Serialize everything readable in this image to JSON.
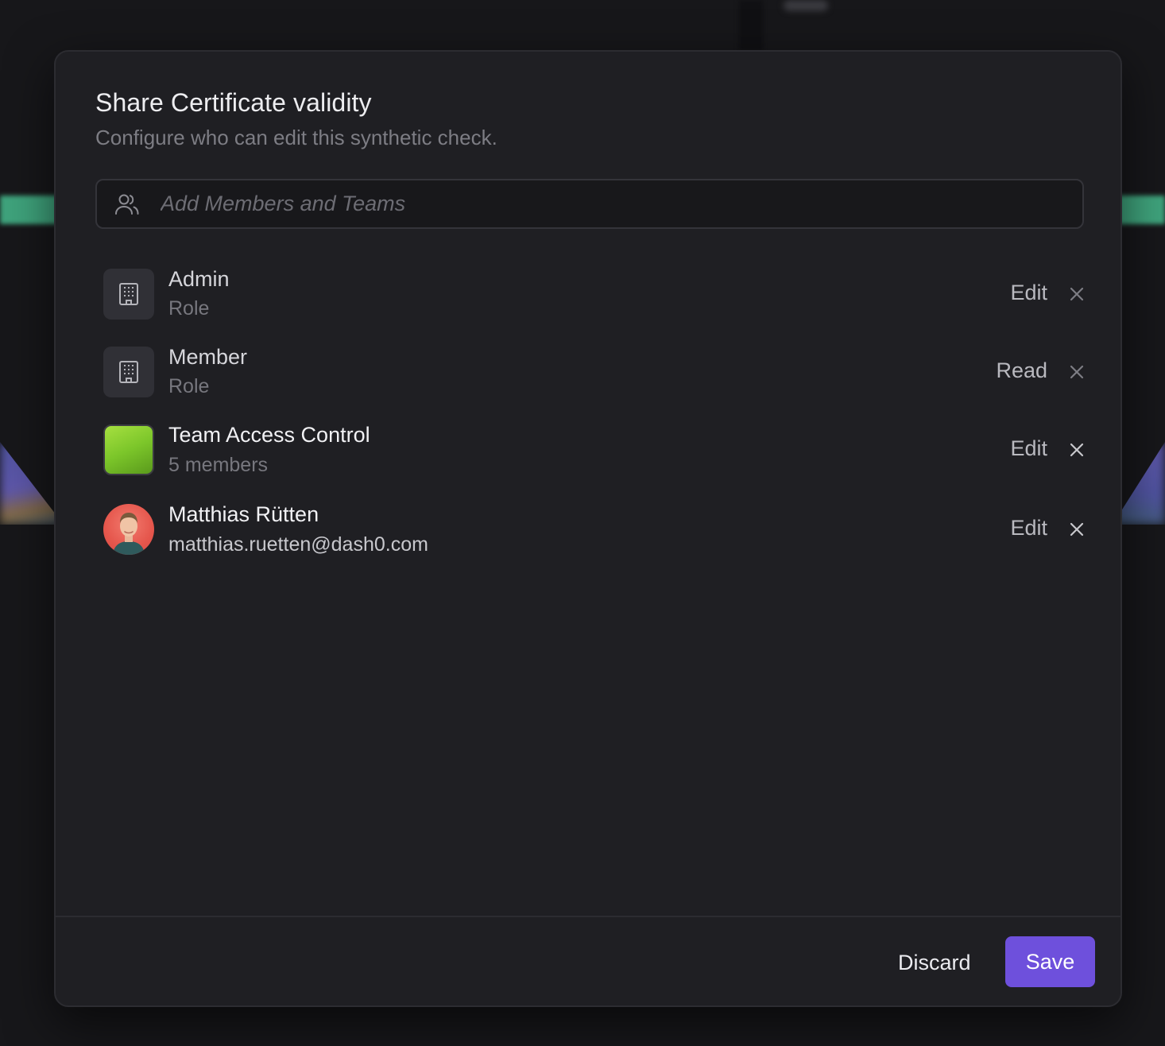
{
  "dialog": {
    "title": "Share Certificate validity",
    "subtitle": "Configure who can edit this synthetic check."
  },
  "search": {
    "placeholder": "Add Members and Teams",
    "icon": "users-icon"
  },
  "entries": [
    {
      "name": "Admin",
      "subtitle": "Role",
      "permission": "Edit",
      "icon": "building-icon",
      "type": "role"
    },
    {
      "name": "Member",
      "subtitle": "Role",
      "permission": "Read",
      "icon": "building-icon",
      "type": "role"
    },
    {
      "name": "Team Access Control",
      "subtitle": "5 members",
      "permission": "Edit",
      "icon": "team-color-swatch",
      "type": "team",
      "color": "#8cd133"
    },
    {
      "name": "Matthias Rütten",
      "subtitle": "matthias.ruetten@dash0.com",
      "permission": "Edit",
      "icon": "user-avatar",
      "type": "user"
    }
  ],
  "footer": {
    "discard_label": "Discard",
    "save_label": "Save"
  },
  "colors": {
    "accent": "#6e50dc",
    "background": "#1f1f23",
    "team_swatch": "#8cd133",
    "avatar_bg": "#e5564c"
  }
}
